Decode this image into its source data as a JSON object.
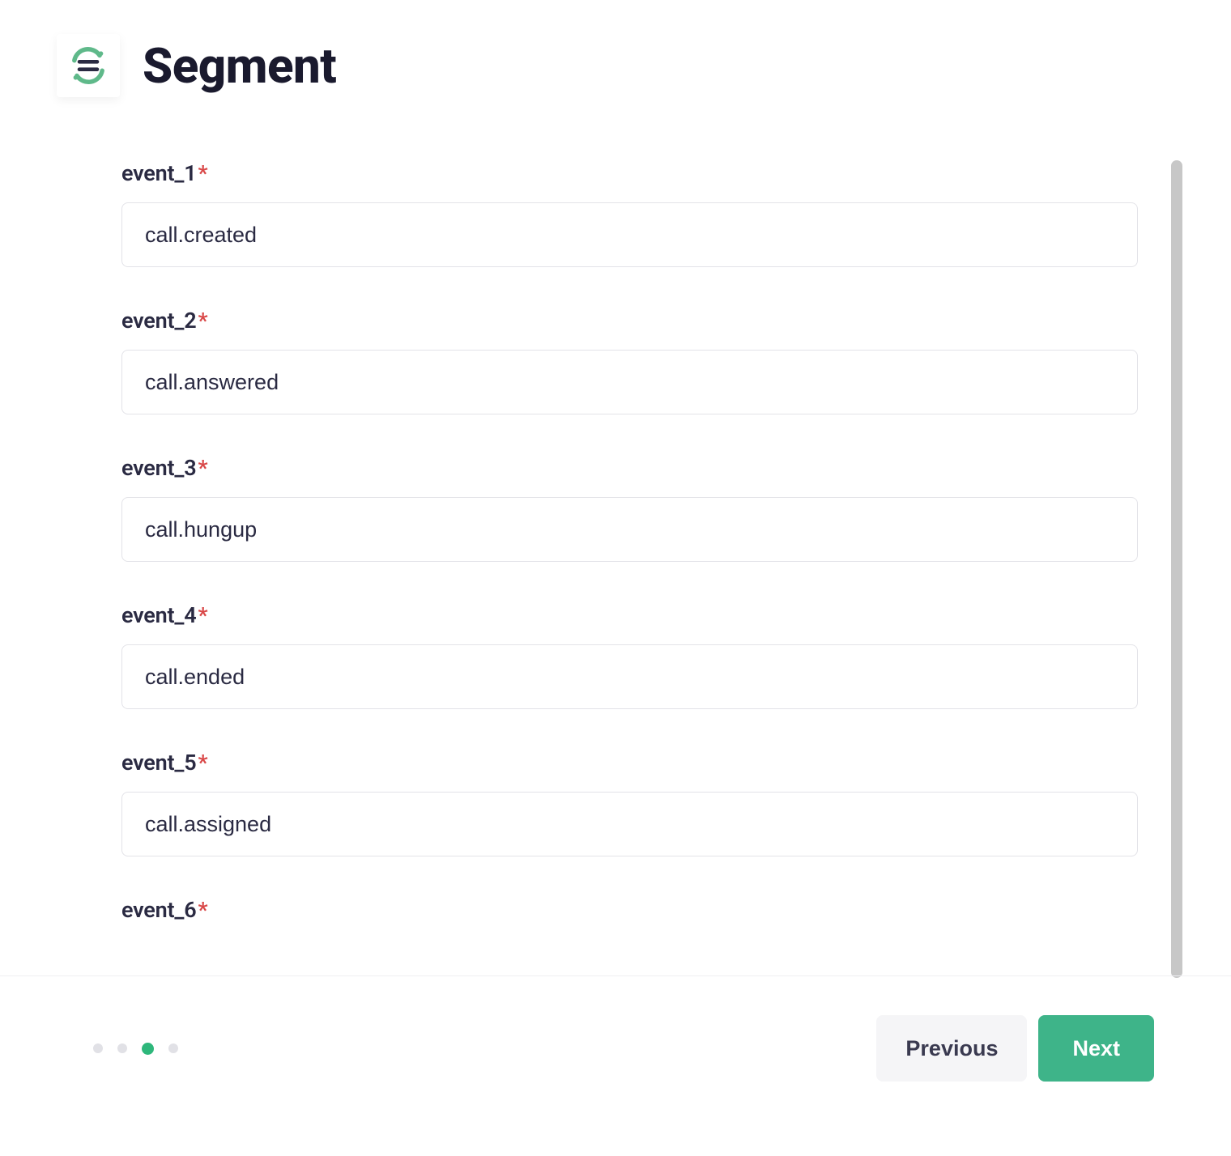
{
  "header": {
    "title": "Segment"
  },
  "form": {
    "fields": [
      {
        "label": "event_1",
        "required": true,
        "value": "call.created"
      },
      {
        "label": "event_2",
        "required": true,
        "value": "call.answered"
      },
      {
        "label": "event_3",
        "required": true,
        "value": "call.hungup"
      },
      {
        "label": "event_4",
        "required": true,
        "value": "call.ended"
      },
      {
        "label": "event_5",
        "required": true,
        "value": "call.assigned"
      },
      {
        "label": "event_6",
        "required": true,
        "value": ""
      }
    ]
  },
  "stepper": {
    "total": 4,
    "active_index": 2
  },
  "footer": {
    "previous_label": "Previous",
    "next_label": "Next"
  },
  "colors": {
    "accent": "#3eb489",
    "required": "#d94848",
    "text": "#2a2a42"
  }
}
